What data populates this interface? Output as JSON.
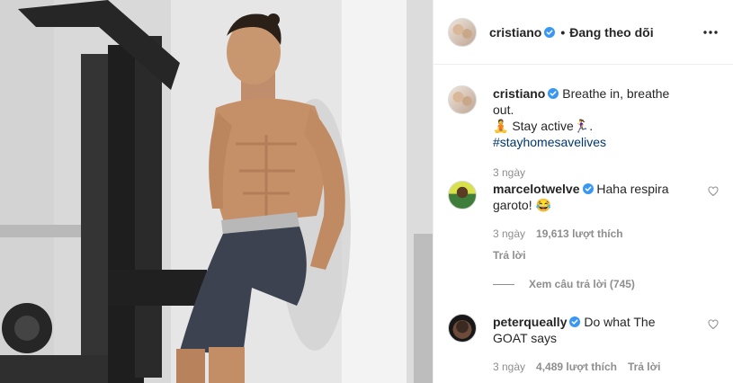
{
  "post": {
    "author": "cristiano",
    "follow_status": "Đang theo dõi",
    "caption": {
      "author": "cristiano",
      "text_line1": "Breathe in, breathe out.",
      "text_line2": "🧘 Stay active🏃‍♀️.",
      "hashtag": "#stayhomesavelives",
      "time": "3 ngày"
    }
  },
  "comments": [
    {
      "author": "marcelotwelve",
      "text": "Haha respira garoto! 😂",
      "time": "3 ngày",
      "likes": "19,613 lượt thích",
      "reply_label": "Trả lời",
      "view_replies": "Xem câu trả lời (745)"
    },
    {
      "author": "peterqueally",
      "text": "Do what The GOAT says",
      "time": "3 ngày",
      "likes": "4,489 lượt thích",
      "reply_label": "Trả lời"
    }
  ],
  "icons": {
    "verified": "verified-badge-icon",
    "more": "more-options-icon",
    "heart": "heart-icon"
  },
  "colors": {
    "verified_blue": "#3897f0",
    "hashtag": "#00376b",
    "muted": "#8e8e8e"
  }
}
